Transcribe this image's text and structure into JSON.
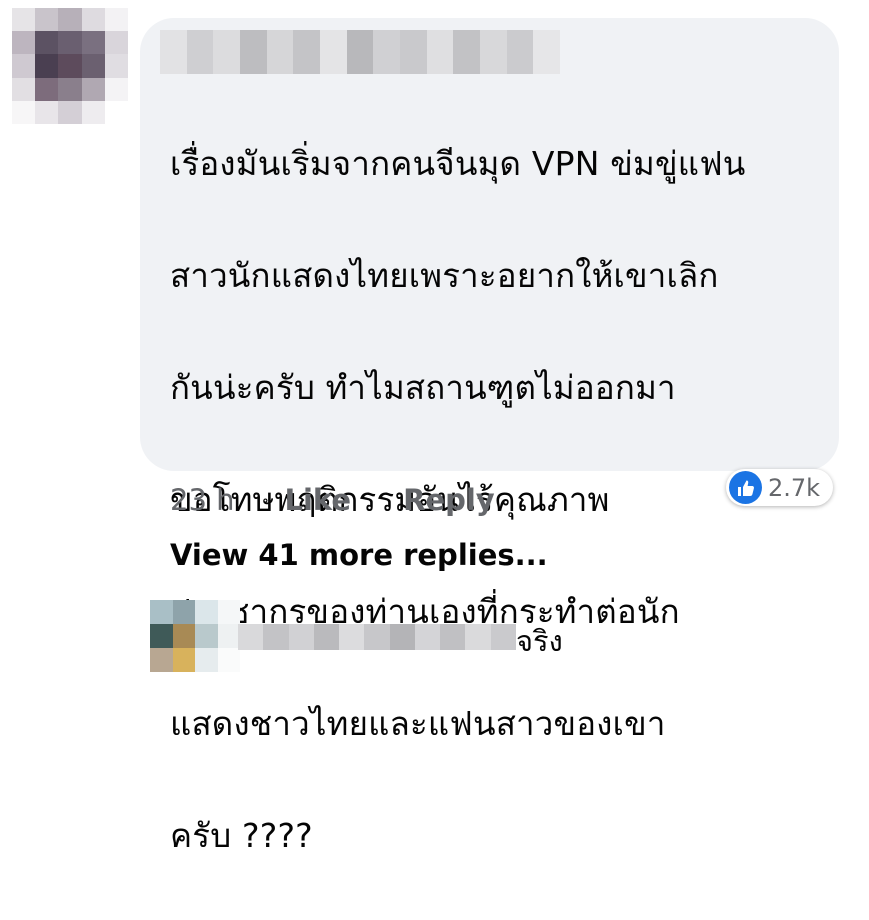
{
  "comment": {
    "lines": [
      "เรื่องมันเริ่มจากคนจีนมุด VPN ข่มขู่แฟน",
      "สาวนักแสดงไทยเพราะอยากให้เขาเลิก",
      "กันน่ะครับ  ทำไมสถานฑูตไม่ออกมา",
      "ขอโทษพฤติกรรมอันไร้คุณภาพ",
      "ประชากรของท่านเองที่กระทำต่อนัก",
      "แสดงชาวไทยและแฟนสาวของเขา",
      "ครับ ????"
    ],
    "time": "23 h",
    "like_label": "Like",
    "reply_label": "Reply",
    "reaction_count": "2.7k",
    "reaction_icon": "thumbs-up-icon",
    "reaction_color": "#1b74e4"
  },
  "view_more_label": "View 41 more replies...",
  "reply": {
    "text": "จริง"
  },
  "colors": {
    "bubble": "#f0f2f5",
    "secondary_text": "#65676b",
    "primary_text": "#050505"
  }
}
